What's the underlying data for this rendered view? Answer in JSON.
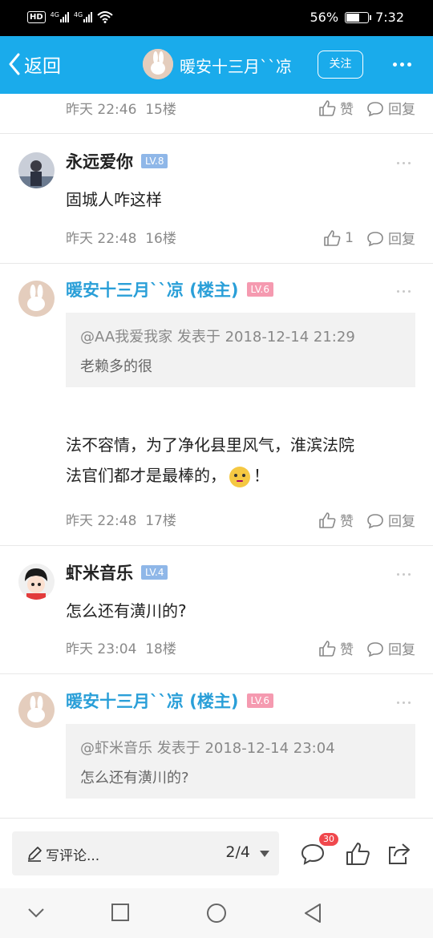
{
  "status_bar": {
    "hd": "HD",
    "signal1": "4G",
    "signal2": "4G",
    "battery": "56%",
    "battery_level": 0.56,
    "time": "7:32"
  },
  "nav": {
    "back_label": "返回",
    "title": "暖安十三月``凉",
    "follow_label": "关注"
  },
  "prev_post": {
    "time": "昨天 22:46",
    "floor": "15楼",
    "like_label": "赞",
    "reply_label": "回复"
  },
  "posts": [
    {
      "user": "永远爱你",
      "level": "LV.8",
      "text": "固城人咋这样",
      "time": "昨天 22:48",
      "floor": "16楼",
      "likes": "1",
      "reply_label": "回复"
    },
    {
      "user": "暖安十三月``凉 (楼主)",
      "level": "LV.6",
      "quote_header": "@AA我爱我家 发表于 2018-12-14 21:29",
      "quote_text": "老赖多的很",
      "text_line1": "法不容情，为了净化县里风气，淮滨法院",
      "text_line2": "法官们都才是最棒的，",
      "text_line2_end": "！",
      "time": "昨天 22:48",
      "floor": "17楼",
      "like_label": "赞",
      "reply_label": "回复"
    },
    {
      "user": "虾米音乐",
      "level": "LV.4",
      "text": "怎么还有潢川的?",
      "time": "昨天 23:04",
      "floor": "18楼",
      "like_label": "赞",
      "reply_label": "回复"
    },
    {
      "user": "暖安十三月``凉 (楼主)",
      "level": "LV.6",
      "quote_header": "@虾米音乐 发表于 2018-12-14 23:04",
      "quote_text": "怎么还有潢川的?"
    }
  ],
  "bottom_bar": {
    "placeholder": "写评论...",
    "page": "2/4",
    "comment_count": "30"
  },
  "colors": {
    "nav_bg": "#1aabeb",
    "host_name": "#2a9fd8",
    "badge": "#f0484d"
  }
}
